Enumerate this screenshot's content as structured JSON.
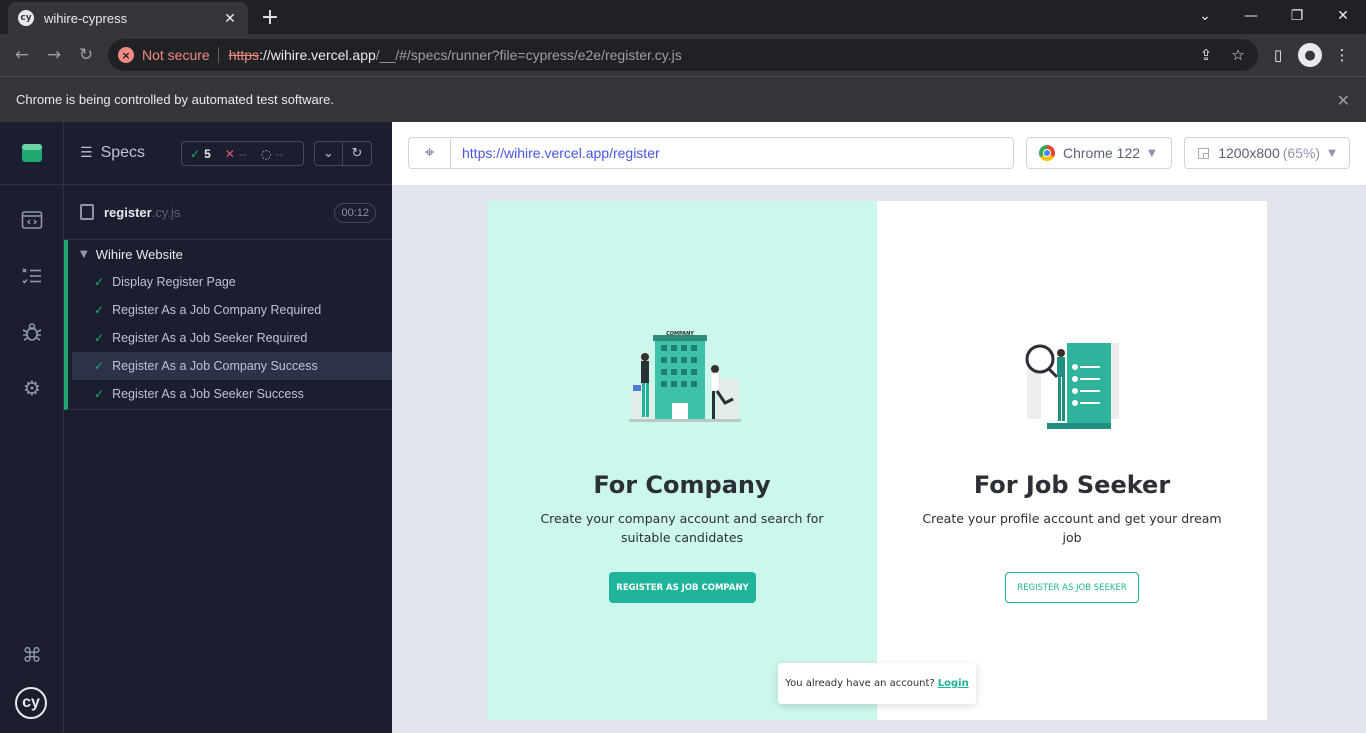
{
  "browser": {
    "tab_title": "wihire-cypress",
    "favicon_text": "cy",
    "security_label": "Not secure",
    "url_scheme": "https",
    "url_host": "://wihire.vercel.app",
    "url_path": "/__/#/specs/runner?file=cypress/e2e/register.cy.js",
    "infobar_text": "Chrome is being controlled by automated test software."
  },
  "reporter": {
    "specs_label": "Specs",
    "passed_count": "5",
    "failed_count": "--",
    "pending_count": "--",
    "file_name": "register",
    "file_ext": ".cy.js",
    "duration": "00:12",
    "suite_title": "Wihire Website",
    "tests": [
      {
        "label": "Display Register Page"
      },
      {
        "label": "Register As a Job Company Required"
      },
      {
        "label": "Register As a Job Seeker Required"
      },
      {
        "label": "Register As a Job Company Success"
      },
      {
        "label": "Register As a Job Seeker Success"
      }
    ]
  },
  "aut": {
    "url": "https://wihire.vercel.app/register",
    "browser_name": "Chrome 122",
    "viewport": "1200x800",
    "zoom": "(65%)"
  },
  "app": {
    "company": {
      "illustration_label": "COMPANY",
      "title": "For Company",
      "description": "Create your company account and search for suitable candidates",
      "button": "REGISTER AS JOB COMPANY"
    },
    "seeker": {
      "title": "For Job Seeker",
      "description": "Create your profile account and get your dream job",
      "button": "REGISTER AS JOB SEEKER"
    },
    "login_prompt": "You already have an account?",
    "login_link": "Login"
  },
  "colors": {
    "accent": "#1fb49a",
    "company_bg": "#ccf7ec",
    "pass": "#1fa971",
    "fail": "#e45770"
  }
}
